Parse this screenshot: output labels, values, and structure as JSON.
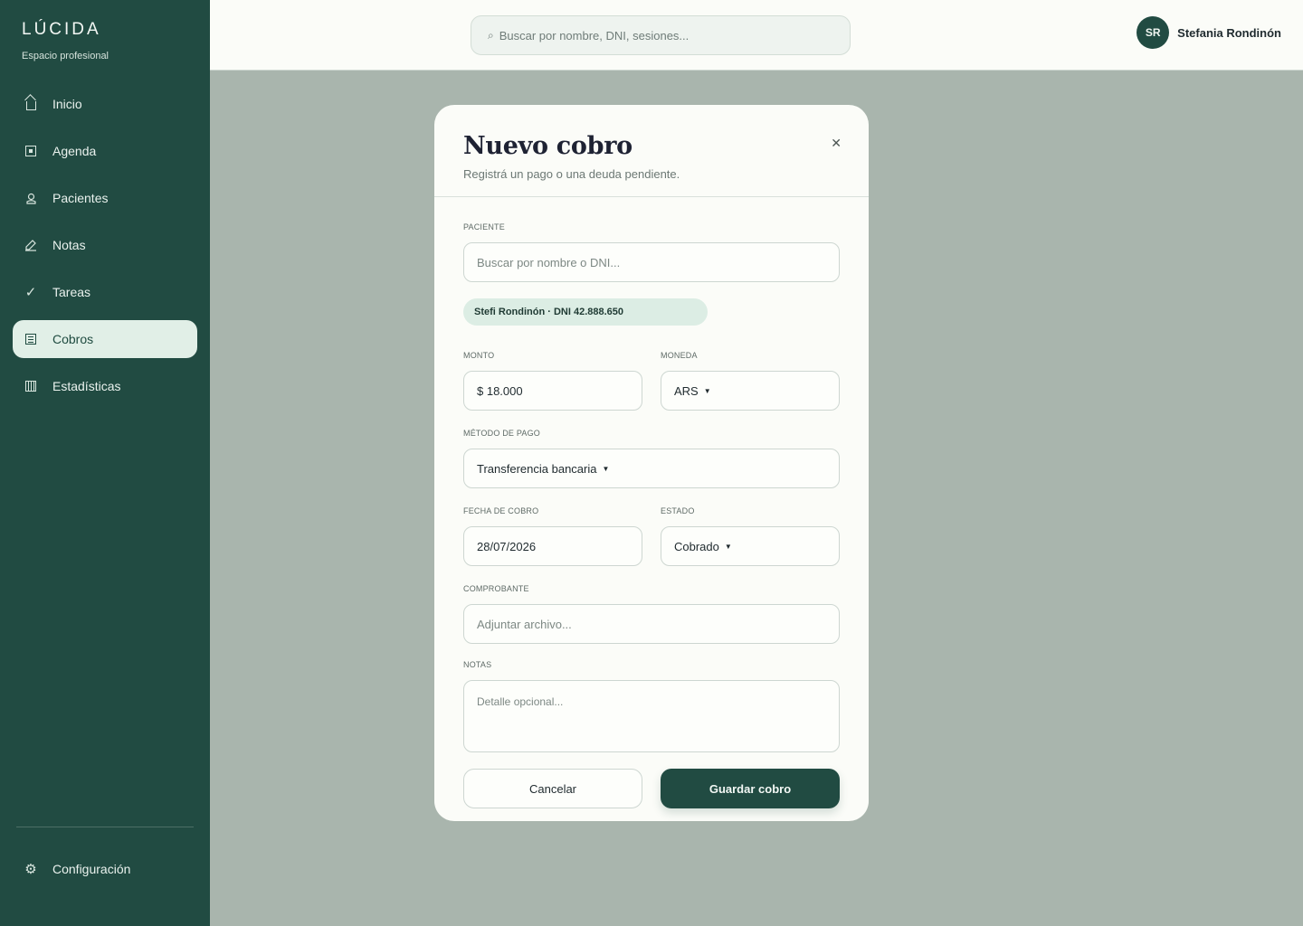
{
  "sidebar": {
    "brand": "LÚCIDA",
    "brand_sub": "Espacio profesional",
    "items": [
      {
        "label": "Inicio",
        "icon": "home-icon"
      },
      {
        "label": "Agenda",
        "icon": "calendar-icon"
      },
      {
        "label": "Pacientes",
        "icon": "patients-icon"
      },
      {
        "label": "Notas",
        "icon": "pen-icon"
      },
      {
        "label": "Tareas",
        "icon": "check-icon"
      },
      {
        "label": "Cobros",
        "icon": "receipt-icon",
        "active": true
      },
      {
        "label": "Estadísticas",
        "icon": "stats-icon"
      }
    ],
    "settings": {
      "label": "Configuración",
      "icon": "gear-icon"
    }
  },
  "topbar": {
    "search_placeholder": "Buscar por nombre, DNI, sesiones...",
    "user": {
      "initials": "SR",
      "name": "Stefania Rondinón"
    }
  },
  "modal": {
    "title": "Nuevo cobro",
    "subtitle": "Registrá un pago o una deuda pendiente.",
    "paciente": {
      "label": "PACIENTE",
      "placeholder": "Buscar por nombre o DNI...",
      "selected": "Stefi Rondinón · DNI 42.888.650"
    },
    "monto": {
      "label": "MONTO",
      "value": "$ 18.000"
    },
    "moneda": {
      "label": "MONEDA",
      "value": "ARS"
    },
    "metodo": {
      "label": "MÉTODO DE PAGO",
      "value": "Transferencia bancaria"
    },
    "fecha": {
      "label": "FECHA DE COBRO",
      "value": "28/07/2026"
    },
    "estado": {
      "label": "ESTADO",
      "value": "Cobrado"
    },
    "comprobante": {
      "label": "COMPROBANTE",
      "placeholder": "Adjuntar archivo..."
    },
    "notas": {
      "label": "NOTAS",
      "placeholder": "Detalle opcional..."
    },
    "cancel_label": "Cancelar",
    "save_label": "Guardar cobro"
  },
  "colors": {
    "sidebar": "#214b42",
    "overlay": "#a9b5ad",
    "active_item": "#e1efe7",
    "chip": "#dcede4"
  }
}
